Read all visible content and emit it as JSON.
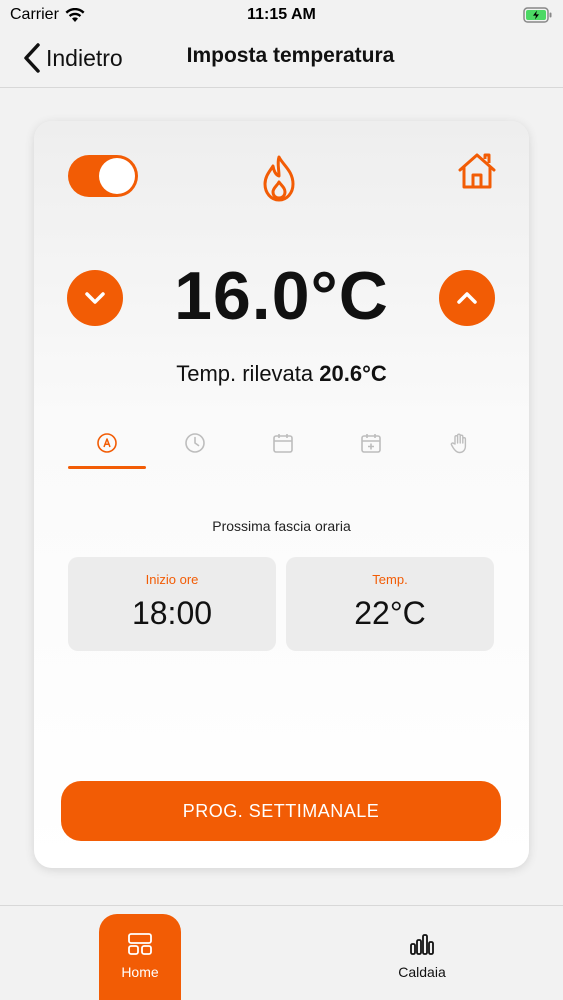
{
  "status_bar": {
    "carrier": "Carrier",
    "time": "11:15 AM"
  },
  "nav": {
    "back_label": "Indietro",
    "title": "Imposta temperatura"
  },
  "thermostat": {
    "power_on": true,
    "setpoint": "16.0°C",
    "measured_label": "Temp. rilevata",
    "measured_value": "20.6°C",
    "mode_tabs": [
      {
        "icon": "auto-icon",
        "active": true
      },
      {
        "icon": "clock-icon",
        "active": false
      },
      {
        "icon": "calendar-icon",
        "active": false
      },
      {
        "icon": "calendar-plus-icon",
        "active": false
      },
      {
        "icon": "hand-icon",
        "active": false
      }
    ],
    "next_slot_label": "Prossima fascia oraria",
    "slot": {
      "start_label": "Inizio ore",
      "start_value": "18:00",
      "temp_label": "Temp.",
      "temp_value": "22°C"
    },
    "program_button": "PROG. SETTIMANALE"
  },
  "tab_bar": {
    "items": [
      {
        "label": "Home",
        "icon": "home-grid-icon",
        "active": true
      },
      {
        "label": "Caldaia",
        "icon": "bar-chart-icon",
        "active": false
      }
    ]
  },
  "colors": {
    "accent": "#f25c05",
    "background": "#f2f2f2",
    "card": "#ffffff",
    "inactive_icon": "#bdbdbd"
  }
}
